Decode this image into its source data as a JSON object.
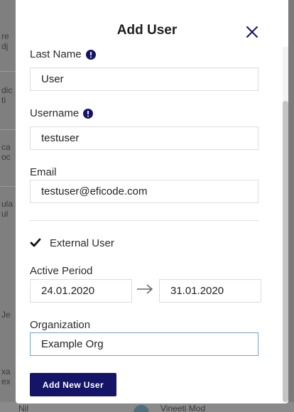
{
  "modal": {
    "title": "Add User",
    "close_icon": "close-icon"
  },
  "form": {
    "last_name": {
      "label": "Last Name",
      "value": "User",
      "info_icon": "info-icon"
    },
    "username": {
      "label": "Username",
      "value": "testuser",
      "info_icon": "info-icon"
    },
    "email": {
      "label": "Email",
      "value": "testuser@eficode.com"
    },
    "external_user": {
      "label": "External User",
      "checked": true
    },
    "active_period": {
      "label": "Active Period",
      "start": "24.01.2020",
      "end": "31.01.2020"
    },
    "organization": {
      "label": "Organization",
      "value": "Example Org"
    },
    "submit_label": "Add New User"
  },
  "background": {
    "fragments": [
      "re",
      "dj",
      "dic",
      "ti",
      "ca",
      "oc",
      "ula",
      "ul",
      "Je",
      "xa",
      "ex"
    ],
    "bottom_left": "Nil",
    "bottom_right": "Vineeti Mod"
  },
  "colors": {
    "primary": "#141567",
    "focus_border": "#6fa4c9",
    "info_icon": "#141567"
  }
}
